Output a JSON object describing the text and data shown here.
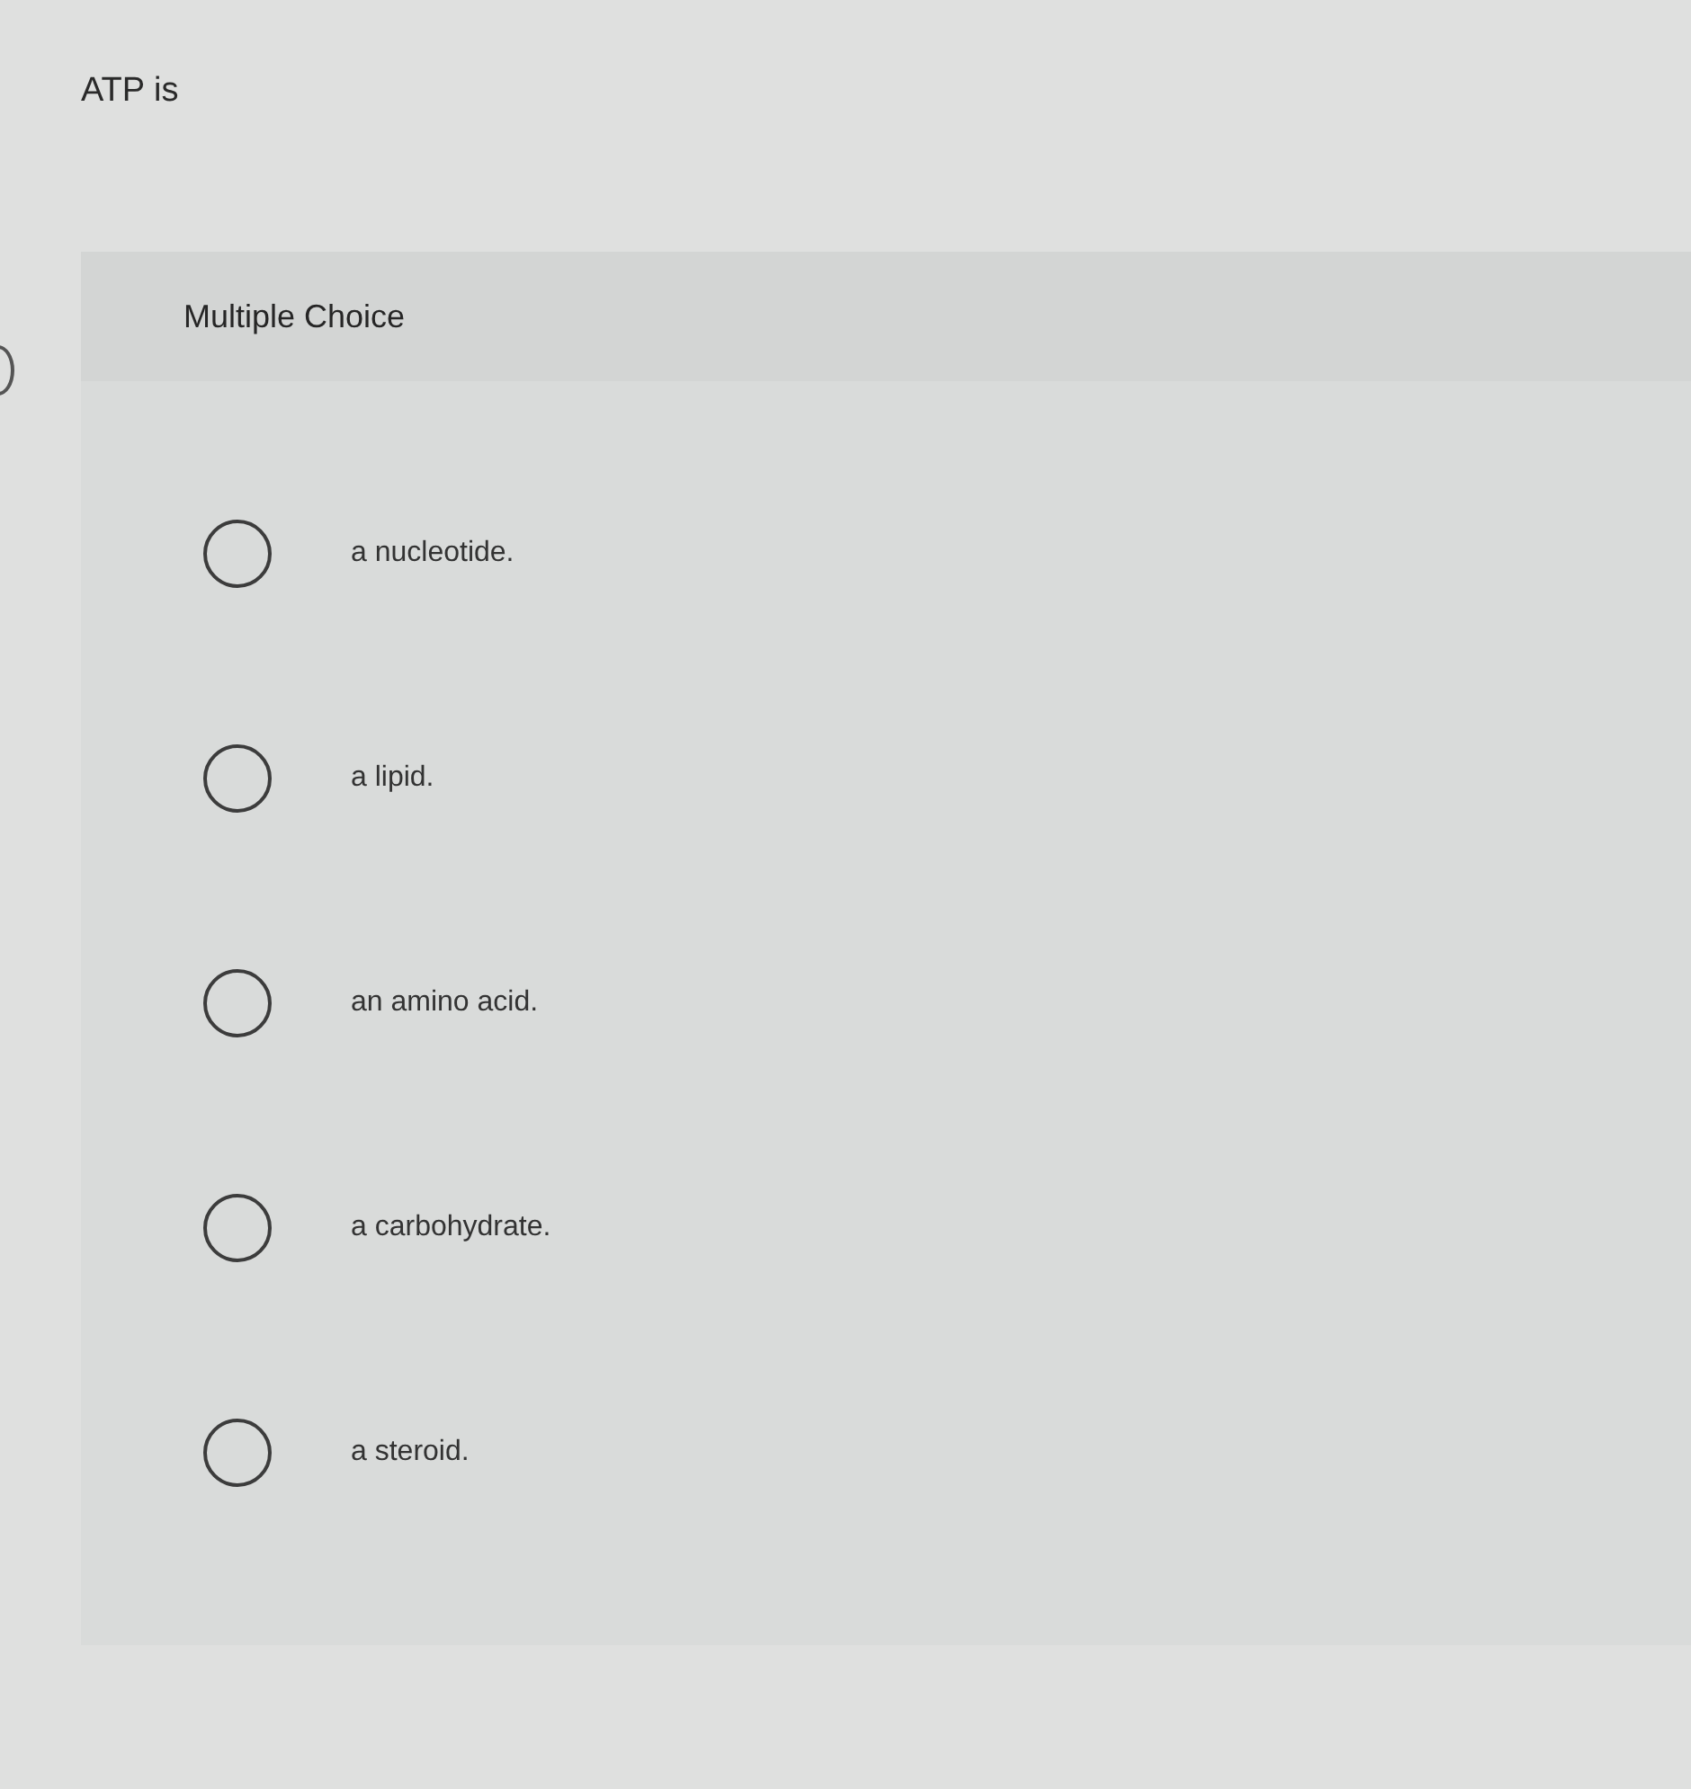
{
  "question": "ATP is",
  "card": {
    "type_label": "Multiple Choice"
  },
  "options": [
    {
      "label": "a nucleotide.",
      "selected": false
    },
    {
      "label": "a lipid.",
      "selected": false
    },
    {
      "label": "an amino acid.",
      "selected": false
    },
    {
      "label": "a carbohydrate.",
      "selected": false
    },
    {
      "label": "a steroid.",
      "selected": false
    }
  ]
}
